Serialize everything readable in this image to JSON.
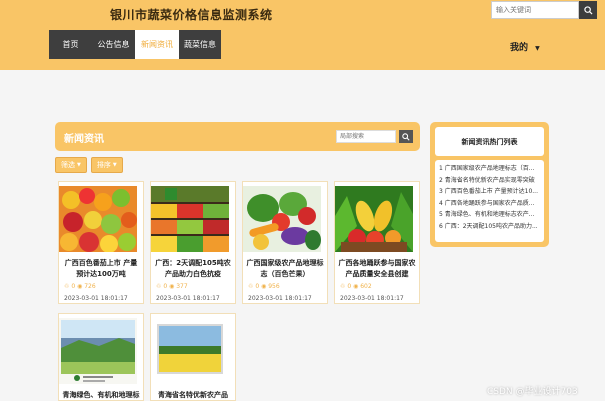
{
  "header": {
    "title": "银川市蔬菜价格信息监测系统",
    "search_placeholder": "输入关键词",
    "nav": [
      "首页",
      "公告信息",
      "新闻资讯",
      "蔬菜信息"
    ],
    "active_nav": "新闻资讯",
    "user_menu": "我的"
  },
  "news": {
    "title": "新闻资讯",
    "search_placeholder": "局部搜索",
    "filters": [
      "筛选",
      "排序"
    ],
    "cards": [
      {
        "title": "广西百色番茄上市 产量预计达100万吨",
        "likes": "0",
        "views": "726",
        "date": "2023-03-01 18:01:17"
      },
      {
        "title": "广西：2天调配105吨农产品助力白色抗疫",
        "likes": "0",
        "views": "377",
        "date": "2023-03-01 18:01:17"
      },
      {
        "title": "广西国家级农产品地理标志（百色芒果）",
        "likes": "0",
        "views": "956",
        "date": "2023-03-01 18:01:17"
      },
      {
        "title": "广西各地踊跃参与国家农产品质量安全县创建",
        "likes": "0",
        "views": "602",
        "date": "2023-03-01 18:01:17"
      },
      {
        "title": "青海绿色、有机和地理标志农产品数量达",
        "likes": "",
        "views": "",
        "date": ""
      },
      {
        "title": "青海省名特优新农产品",
        "likes": "",
        "views": "",
        "date": ""
      }
    ]
  },
  "hot": {
    "title": "新闻资讯热门列表",
    "items": [
      "1  广西国家级农产品地理标志（百...",
      "2  青海省名特优新农产品实现零突破",
      "3  广西百色番茄上市 产量预计达10...",
      "4  广西各地踊跃参与国家农产品质...",
      "5  青海绿色、有机和地理标志农产...",
      "6  广西：2天调配105吨农产品助力..."
    ]
  },
  "watermark": "CSDN @毕业设计703"
}
